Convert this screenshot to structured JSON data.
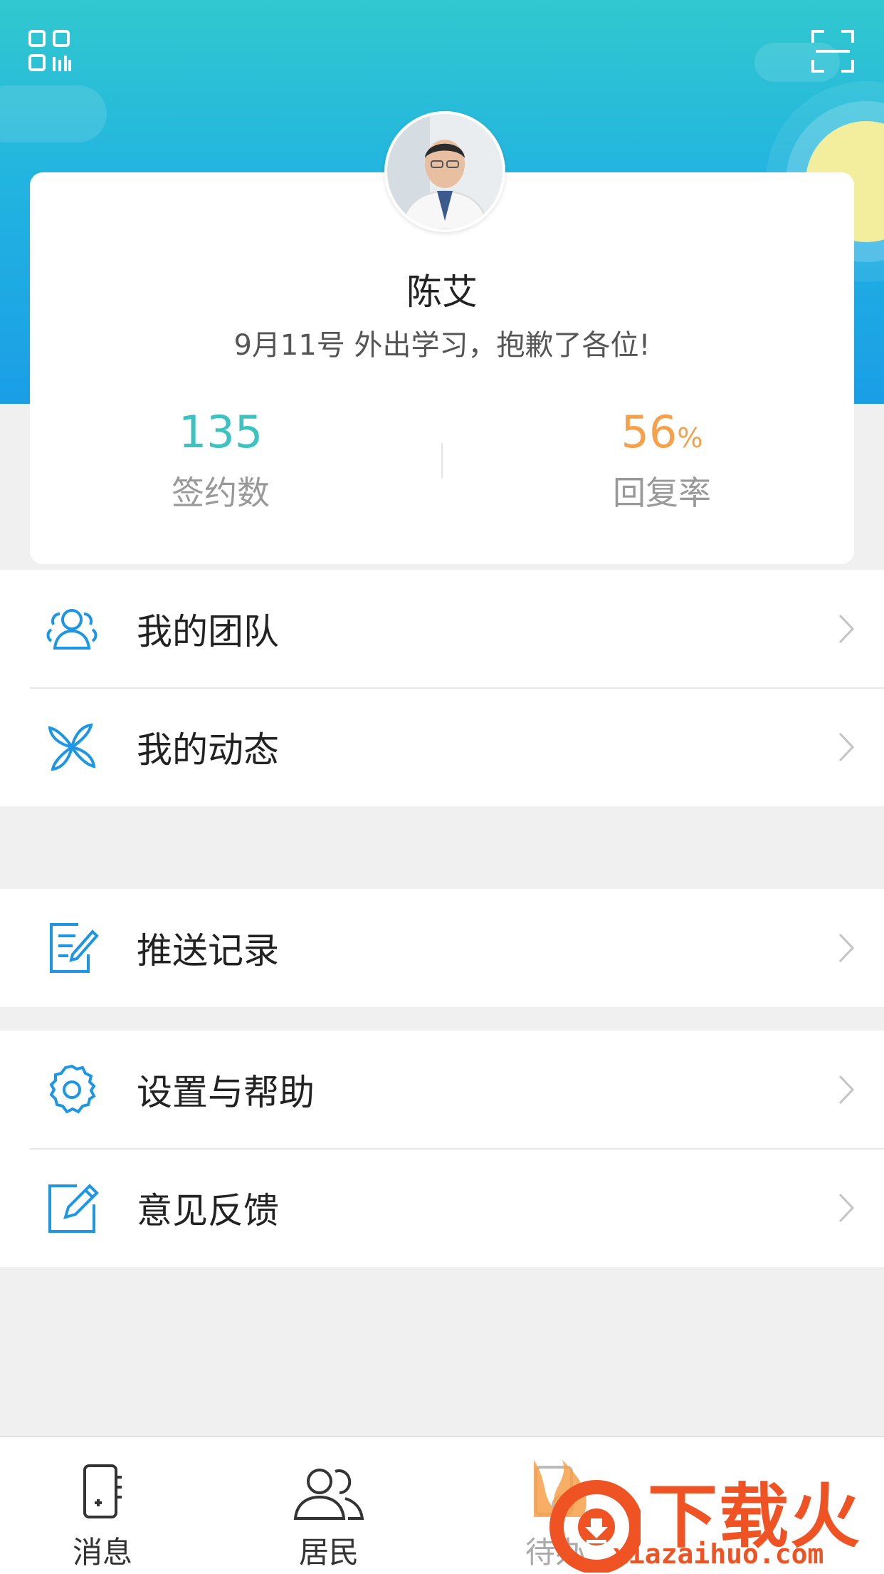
{
  "profile": {
    "name": "陈艾",
    "motto": "9月11号 外出学习，抱歉了各位!",
    "stats": [
      {
        "value": "135",
        "unit": "",
        "label": "签约数",
        "color": "#3cc3c1"
      },
      {
        "value": "56",
        "unit": "%",
        "label": "回复率",
        "color": "#f5a04a"
      }
    ]
  },
  "menu": {
    "group1": [
      {
        "label": "我的团队",
        "icon": "team-icon"
      },
      {
        "label": "我的动态",
        "icon": "pinwheel-icon"
      }
    ],
    "group2": [
      {
        "label": "推送记录",
        "icon": "push-record-icon"
      }
    ],
    "group3": [
      {
        "label": "设置与帮助",
        "icon": "gear-icon"
      },
      {
        "label": "意见反馈",
        "icon": "feedback-edit-icon"
      }
    ]
  },
  "tabbar": {
    "tabs": [
      {
        "label": "消息",
        "icon": "message-icon"
      },
      {
        "label": "居民",
        "icon": "residents-icon"
      },
      {
        "label": "待办",
        "icon": "todo-icon"
      }
    ]
  },
  "watermark": {
    "text": "下载火",
    "domain": "xiazaihuo.com"
  },
  "colors": {
    "header_top": "#31c8cf",
    "header_bottom": "#1a9ee6",
    "icon_blue": "#1e96e6",
    "accent_teal": "#3cc3c1",
    "accent_orange": "#f5a04a",
    "watermark_orange": "#ef5323"
  }
}
